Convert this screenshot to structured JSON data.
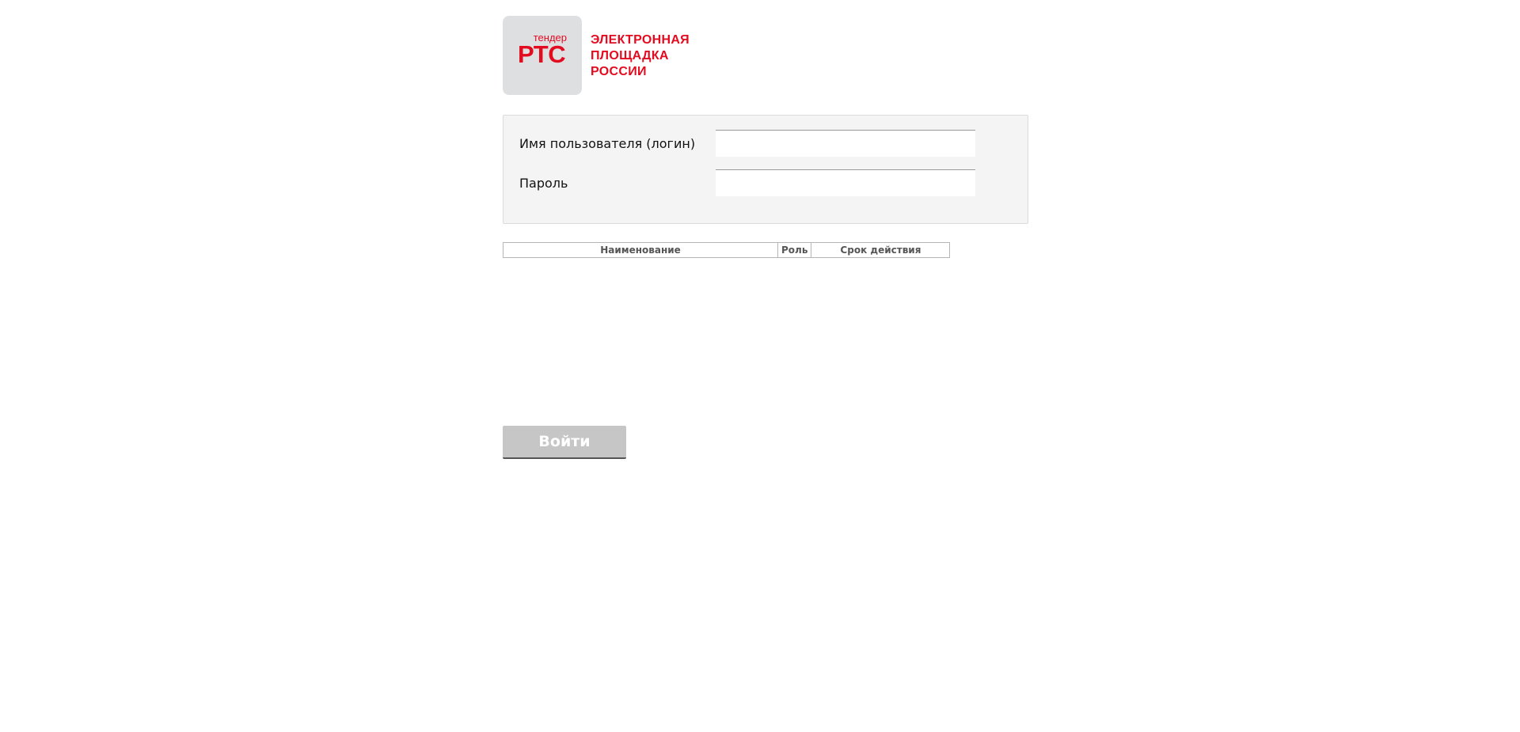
{
  "logo": {
    "small_text": "тендер",
    "big_text": "РТС",
    "title_lines": [
      "ЭЛЕКТРОННАЯ",
      "ПЛОЩАДКА",
      "РОССИИ"
    ],
    "brand_color": "#e30b20"
  },
  "login_form": {
    "username_label": "Имя пользователя (логин)",
    "username_value": "",
    "password_label": "Пароль",
    "password_value": ""
  },
  "certificates_table": {
    "columns": [
      "Наименование",
      "Роль",
      "Срок действия"
    ],
    "rows": []
  },
  "submit_button": {
    "label": "Войти"
  }
}
